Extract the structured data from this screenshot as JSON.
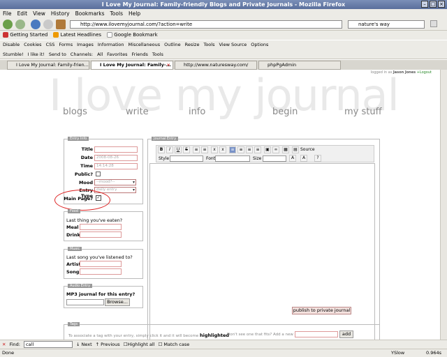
{
  "window": {
    "title": "I Love My Journal: Family-friendly Blogs and Private Journals - Mozilla Firefox"
  },
  "menu": [
    "File",
    "Edit",
    "View",
    "History",
    "Bookmarks",
    "Tools",
    "Help"
  ],
  "nav": {
    "url": "http://www.ilovemyjournal.com/?action=write",
    "search": "nature's way"
  },
  "bookmarks": [
    "Getting Started",
    "Latest Headlines",
    "Google Bookmark"
  ],
  "devbar": [
    "Disable",
    "Cookies",
    "CSS",
    "Forms",
    "Images",
    "Information",
    "Miscellaneous",
    "Outline",
    "Resize",
    "Tools",
    "View Source",
    "Options"
  ],
  "stumble": [
    "Stumble!",
    "I like it!",
    "Send to",
    "Channels:",
    "All",
    "Favorites",
    "Friends",
    "Tools"
  ],
  "tabs": [
    "I Love My Journal: Family-frien...",
    "I Love My Journal: Family-...",
    "http://www.naturesway.com/",
    "phpPgAdmin"
  ],
  "page": {
    "logged_prefix": "logged in as",
    "user": "Jason Jones",
    "logout": "+Logout",
    "site_title": "I love my journal",
    "nav": [
      "blogs",
      "write",
      "info",
      "begin",
      "my stuff"
    ],
    "entry_info": {
      "legend": "Entry Info",
      "title_label": "Title",
      "date_label": "Date",
      "date_value": "2008-08-26",
      "time_label": "Time",
      "time_value": "14:14:28",
      "public_label": "Public?",
      "mood_label": "Mood",
      "mood_value": "--mood?--",
      "type_label": "Entry Type",
      "type_value": "daily entry",
      "main_label": "Main Page?",
      "main_check": "✓"
    },
    "food": {
      "legend": "Food",
      "prompt": "Last thing you've eaten?",
      "meal": "Meal",
      "drink": "Drink"
    },
    "music": {
      "legend": "Music",
      "prompt": "Last song you've listened to?",
      "artist": "Artist",
      "song": "Song"
    },
    "audio": {
      "legend": "Audio Entry",
      "prompt": "MP3 journal for this entry?",
      "browse": "Browse..."
    },
    "journal": {
      "legend": "Journal Entry",
      "style": "Style",
      "font": "Font",
      "size": "Size",
      "source": "Source"
    },
    "publish": "publish to private journal",
    "tags": {
      "legend": "Tags",
      "hint": "To associate a tag with your entry, simply click it and it will become",
      "highlighted": "highlighted",
      "new_hint": "Don't see one that fits? Add a new one!",
      "add": "add"
    }
  },
  "find": {
    "label": "Find:",
    "value": "call",
    "next": "Next",
    "previous": "Previous",
    "highlight": "Highlight all",
    "match": "Match case"
  },
  "status": {
    "text": "Done",
    "yslow": "YSlow",
    "time": "0.964s"
  }
}
